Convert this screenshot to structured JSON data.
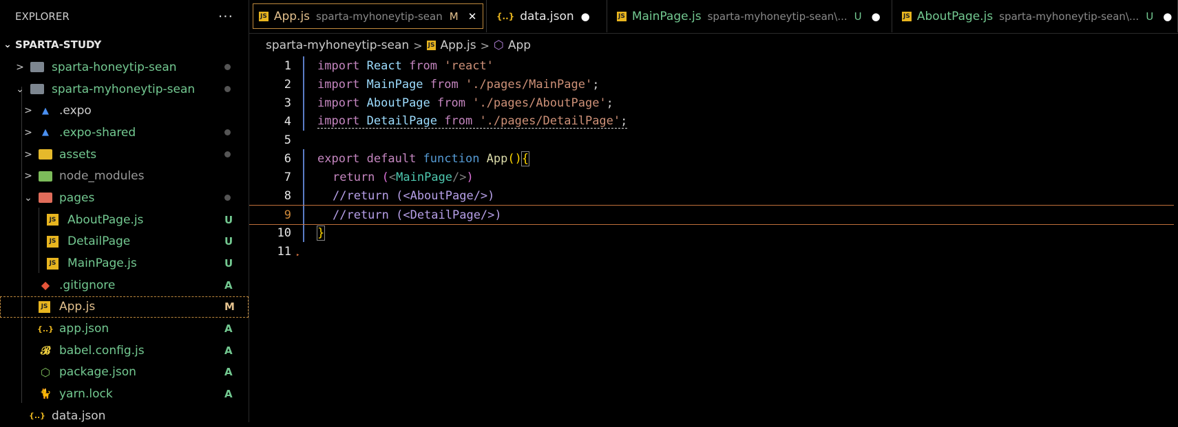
{
  "explorer": {
    "header": "EXPLORER",
    "more": "···",
    "root": "SPARTA-STUDY",
    "items": [
      {
        "label": "sparta-honeytip-sean",
        "type": "folder",
        "status": "dot"
      },
      {
        "label": "sparta-myhoneytip-sean",
        "type": "folder-open",
        "status": "dot"
      },
      {
        "label": ".expo",
        "type": "expo",
        "status": ""
      },
      {
        "label": ".expo-shared",
        "type": "expo",
        "status": "dot"
      },
      {
        "label": "assets",
        "type": "assets",
        "status": "dot"
      },
      {
        "label": "node_modules",
        "type": "node",
        "status": ""
      },
      {
        "label": "pages",
        "type": "pages",
        "status": "dot"
      },
      {
        "label": "AboutPage.js",
        "type": "js",
        "status": "U"
      },
      {
        "label": "DetailPage",
        "type": "js",
        "status": "U"
      },
      {
        "label": "MainPage.js",
        "type": "js",
        "status": "U"
      },
      {
        "label": ".gitignore",
        "type": "git",
        "status": "A"
      },
      {
        "label": "App.js",
        "type": "js",
        "status": "M"
      },
      {
        "label": "app.json",
        "type": "json",
        "status": "A"
      },
      {
        "label": "babel.config.js",
        "type": "babel",
        "status": "A"
      },
      {
        "label": "package.json",
        "type": "npm",
        "status": "A"
      },
      {
        "label": "yarn.lock",
        "type": "yarn",
        "status": "A"
      },
      {
        "label": "data.json",
        "type": "json",
        "status": ""
      }
    ]
  },
  "tabs": [
    {
      "label": "App.js",
      "desc": "sparta-myhoneytip-sean",
      "state": "M",
      "close": "✕",
      "icon": "JS"
    },
    {
      "label": "data.json",
      "desc": "",
      "state": "●",
      "icon": "{..}"
    },
    {
      "label": "MainPage.js",
      "desc": "sparta-myhoneytip-sean\\...",
      "state": "U",
      "dot": "●",
      "icon": "JS"
    },
    {
      "label": "AboutPage.js",
      "desc": "sparta-myhoneytip-sean\\...",
      "state": "U",
      "dot": "●",
      "icon": "JS"
    }
  ],
  "breadcrumb": {
    "folder": "sparta-myhoneytip-sean",
    "file": "App.js",
    "symbol": "App",
    "sep": ">"
  },
  "code": {
    "line_numbers": [
      "1",
      "2",
      "3",
      "4",
      "5",
      "6",
      "7",
      "8",
      "9",
      "10",
      "11"
    ],
    "l1": [
      "import",
      " React ",
      "from",
      " 'react'"
    ],
    "l2": [
      "import",
      " MainPage ",
      "from",
      " './pages/MainPage'",
      ";"
    ],
    "l3": [
      "import",
      " AboutPage ",
      "from",
      " './pages/AboutPage'",
      ";"
    ],
    "l4": [
      "import",
      " DetailPage ",
      "from",
      " './pages/DetailPage'",
      ";"
    ],
    "l6": [
      "export",
      " default ",
      "function",
      " App",
      "()",
      "{"
    ],
    "l7": [
      "return",
      " (",
      "<",
      "MainPage",
      "/>",
      ")"
    ],
    "l8": "//return (<AboutPage/>)",
    "l9": "//return (<DetailPage/>)",
    "l10": "}"
  },
  "colors": {
    "accent": "#c08a3e",
    "status_added": "#73c991",
    "status_modified": "#e2c08d",
    "status_untracked": "#73c991"
  }
}
